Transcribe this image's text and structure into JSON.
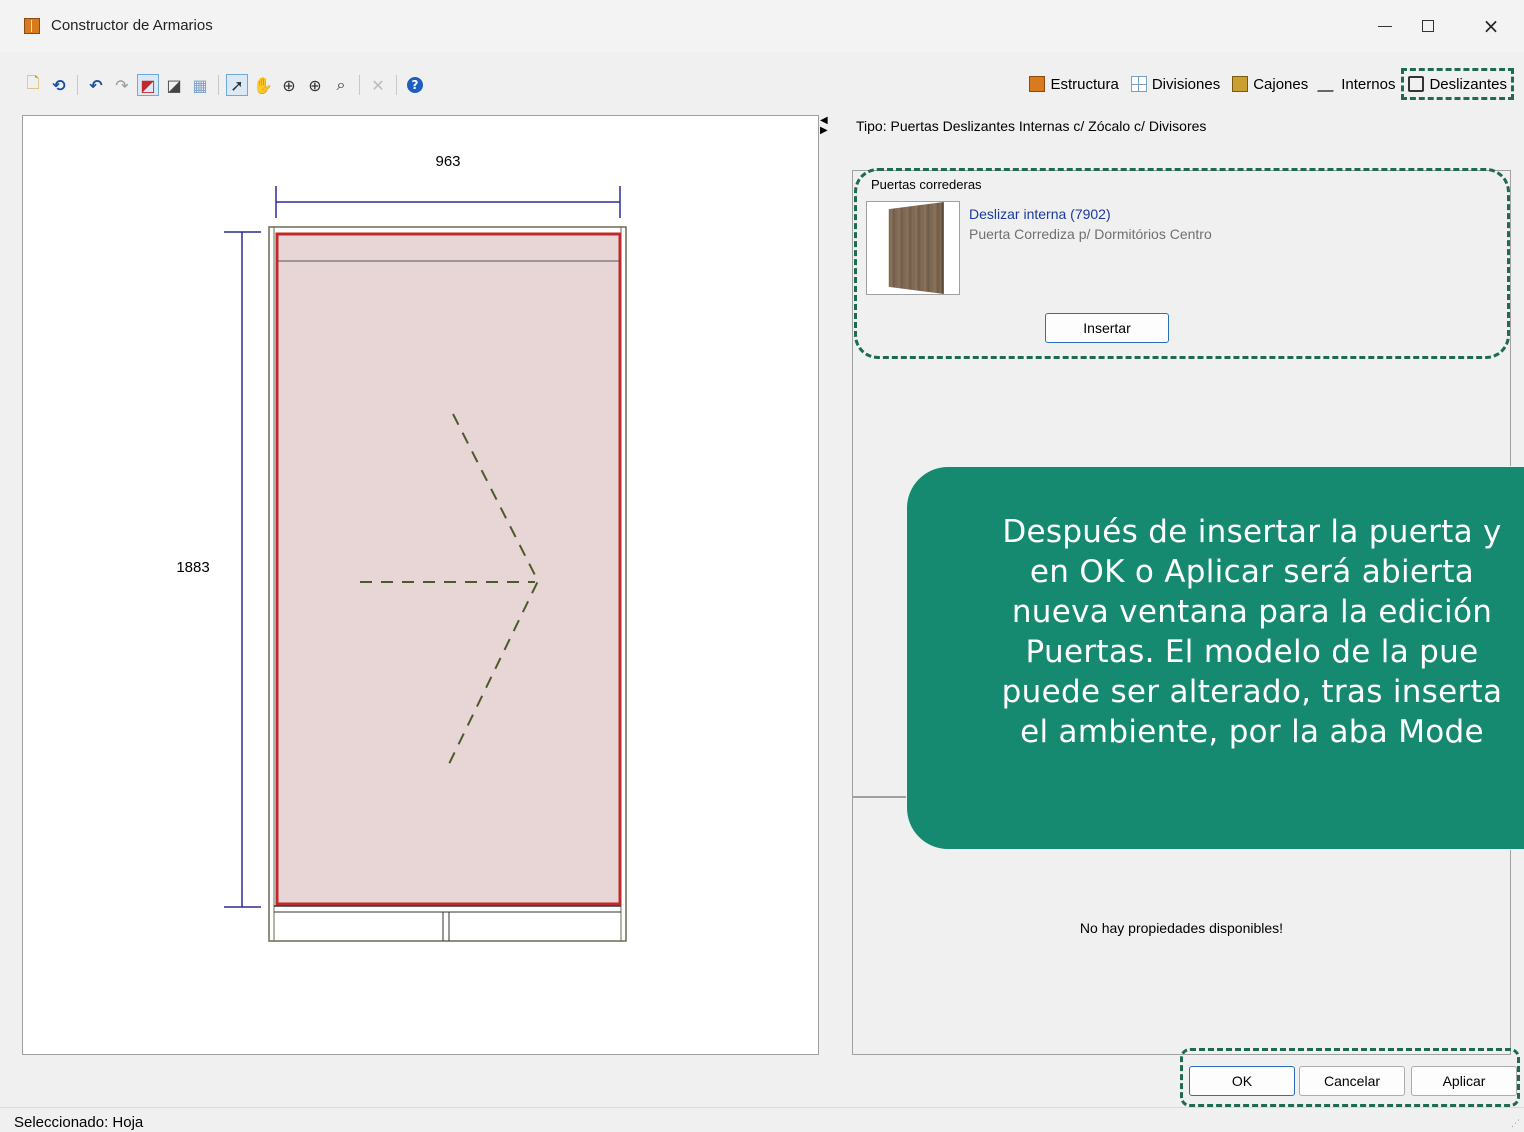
{
  "window": {
    "title": "Constructor de Armarios",
    "app_icon": "wardrobe-icon",
    "controls": {
      "minimize": "minimize-icon",
      "maximize": "maximize-icon",
      "close": "close-icon"
    }
  },
  "toolbar": {
    "tools": [
      {
        "name": "new-icon",
        "glyph": "🗋"
      },
      {
        "name": "reset-icon",
        "glyph": "⟲"
      },
      {
        "name": "undo-icon",
        "glyph": "↶"
      },
      {
        "name": "redo-icon",
        "glyph": "↷"
      },
      {
        "name": "draw-edge-icon",
        "glyph": "◩"
      },
      {
        "name": "mirror-icon",
        "glyph": "◪"
      },
      {
        "name": "grid-icon",
        "glyph": "▦"
      },
      {
        "name": "select-pointer-icon",
        "glyph": "➚"
      },
      {
        "name": "pan-hand-icon",
        "glyph": "✋"
      },
      {
        "name": "zoom-window-icon",
        "glyph": "⊕"
      },
      {
        "name": "zoom-in-icon",
        "glyph": "⊕"
      },
      {
        "name": "zoom-fit-icon",
        "glyph": "⌕"
      },
      {
        "name": "delete-icon",
        "glyph": "✕"
      },
      {
        "name": "help-icon",
        "glyph": "?"
      }
    ],
    "tabs": [
      {
        "label": "Estructura",
        "icon": "structure-icon"
      },
      {
        "label": "Divisiones",
        "icon": "divisions-icon"
      },
      {
        "label": "Cajones",
        "icon": "drawers-icon"
      },
      {
        "label": "Internos",
        "icon": "internals-icon"
      },
      {
        "label": "Deslizantes",
        "icon": "sliding-doors-icon",
        "active": true
      }
    ]
  },
  "drawing": {
    "width_dim": "963",
    "height_dim": "1883",
    "colors": {
      "panel_fill": "#e8d6d6",
      "panel_border": "#c0282a",
      "dimension": "#2b2b9a",
      "arrow": "#4c5a2a"
    }
  },
  "panel": {
    "tipo": "Tipo: Puertas Deslizantes Internas c/ Zócalo c/ Divisores",
    "group_title": "Puertas correderas",
    "door": {
      "name": "Deslizar interna (7902)",
      "description": "Puerta Corrediza p/ Dormitórios Centro"
    },
    "insert_label": "Insertar",
    "no_props": "No hay propiedades disponibles!"
  },
  "callout": {
    "lines": [
      "Después de insertar la puerta y",
      "en OK o Aplicar será abierta",
      "nueva ventana para la edición",
      "Puertas. El modelo de la pue",
      "puede ser alterado, tras inserta",
      "el ambiente, por la aba Mode"
    ],
    "color": "#168a70"
  },
  "buttons": {
    "ok": "OK",
    "cancel": "Cancelar",
    "apply": "Aplicar"
  },
  "status": {
    "text": "Seleccionado: Hoja"
  }
}
